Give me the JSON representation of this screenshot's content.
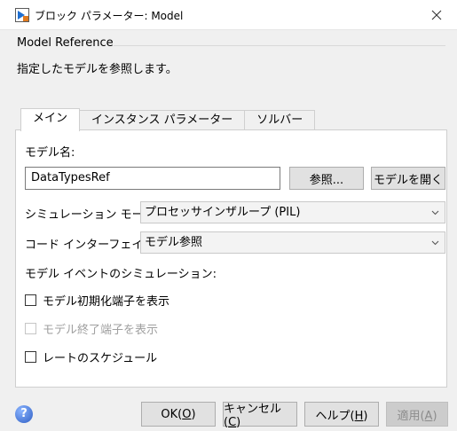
{
  "window": {
    "title": "ブロック パラメーター: Model",
    "icons": {
      "app": "simulink-block-icon",
      "close": "close-icon"
    }
  },
  "header": {
    "section_title": "Model Reference",
    "description": "指定したモデルを参照します。"
  },
  "tabs": [
    {
      "label": "メイン",
      "active": true
    },
    {
      "label": "インスタンス パラメーター",
      "active": false
    },
    {
      "label": "ソルバー",
      "active": false
    }
  ],
  "main": {
    "model_name_label": "モデル名:",
    "model_name_value": "DataTypesRef",
    "browse_button": "参照...",
    "open_model_button": "モデルを開く",
    "simulation_mode_label": "シミュレーション モード:",
    "simulation_mode_value": "プロセッサインザループ (PIL)",
    "code_interface_label": "コード インターフェイス:",
    "code_interface_value": "モデル参照",
    "events_label": "モデル イベントのシミュレーション:",
    "checkboxes": [
      {
        "label": "モデル初期化端子を表示",
        "checked": false,
        "enabled": true
      },
      {
        "label": "モデル終了端子を表示",
        "checked": false,
        "enabled": false
      },
      {
        "label": "レートのスケジュール",
        "checked": false,
        "enabled": true
      }
    ]
  },
  "footer": {
    "help_icon": "help-icon",
    "ok": "OK(O)",
    "ok_mnemonic": "O",
    "cancel": "キャンセル(C)",
    "cancel_mnemonic": "C",
    "help": "ヘルプ(H)",
    "help_mnemonic": "H",
    "apply": "適用(A)",
    "apply_mnemonic": "A",
    "apply_enabled": false
  }
}
